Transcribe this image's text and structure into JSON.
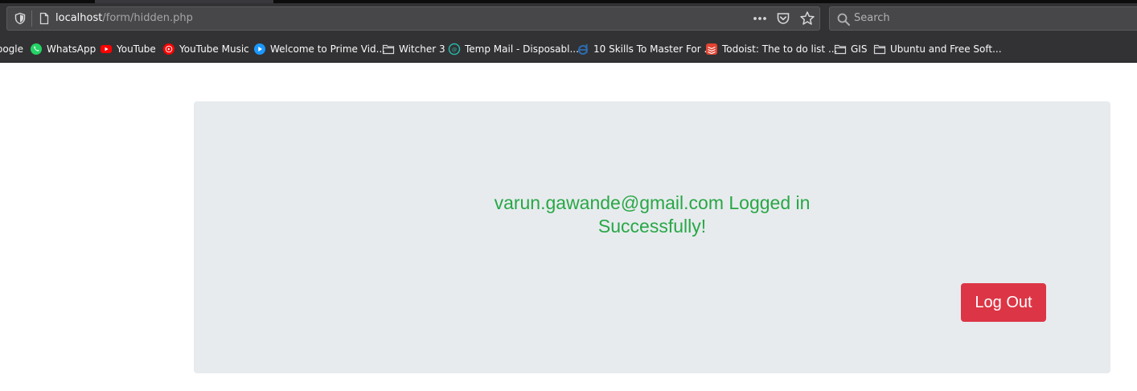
{
  "browser": {
    "url_host": "localhost",
    "url_path": "/form/hidden.php",
    "search_placeholder": "Search",
    "icons": {
      "shield": "tracking-protection-shield-icon",
      "page": "page-info-icon",
      "menu": "page-actions-dots-icon",
      "pocket": "pocket-icon",
      "bookmark": "bookmark-star-icon",
      "search": "search-icon"
    }
  },
  "bookmarks": [
    {
      "label": "oogle",
      "icon": "google-icon"
    },
    {
      "label": "WhatsApp",
      "icon": "whatsapp-icon",
      "color": "#25d366"
    },
    {
      "label": "YouTube",
      "icon": "youtube-icon",
      "color": "#ff0000"
    },
    {
      "label": "YouTube Music",
      "icon": "youtube-music-icon",
      "color": "#ff0000"
    },
    {
      "label": "Welcome to Prime Vid...",
      "icon": "prime-video-icon",
      "color": "#1a98ff"
    },
    {
      "label": "Witcher 3",
      "icon": "folder-icon"
    },
    {
      "label": "Temp Mail - Disposabl...",
      "icon": "temp-mail-icon",
      "color": "#29b6a8"
    },
    {
      "label": "10 Skills To Master For ...",
      "icon": "site-icon",
      "color": "#2b6cb0"
    },
    {
      "label": "Todoist: The to do list ...",
      "icon": "todoist-icon",
      "color": "#e44332"
    },
    {
      "label": "GIS",
      "icon": "folder-icon"
    },
    {
      "label": "Ubuntu and Free Soft...",
      "icon": "folder-icon"
    }
  ],
  "main": {
    "message_line1": "varun.gawande@gmail.com Logged in",
    "message_line2": "Successfully!",
    "logout_label": "Log Out",
    "message_color": "#28a745",
    "button_color": "#dc3545",
    "panel_color": "#e7ebee"
  }
}
